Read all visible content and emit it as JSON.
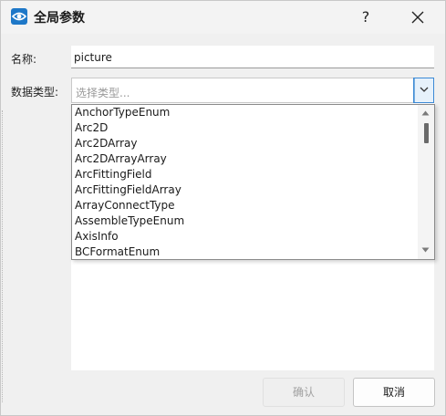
{
  "window": {
    "title": "全局参数",
    "help_label": "?"
  },
  "form": {
    "name_label": "名称:",
    "name_value": "picture",
    "type_label": "数据类型:",
    "type_placeholder": "选择类型..."
  },
  "dropdown": {
    "items": [
      "AnchorTypeEnum",
      "Arc2D",
      "Arc2DArray",
      "Arc2DArrayArray",
      "ArcFittingField",
      "ArcFittingFieldArray",
      "ArrayConnectType",
      "AssembleTypeEnum",
      "AxisInfo",
      "BCFormatEnum"
    ]
  },
  "buttons": {
    "ok_label": "确认",
    "cancel_label": "取消"
  },
  "colors": {
    "app_icon": "#1e78c8",
    "accent": "#3c8ad6"
  }
}
